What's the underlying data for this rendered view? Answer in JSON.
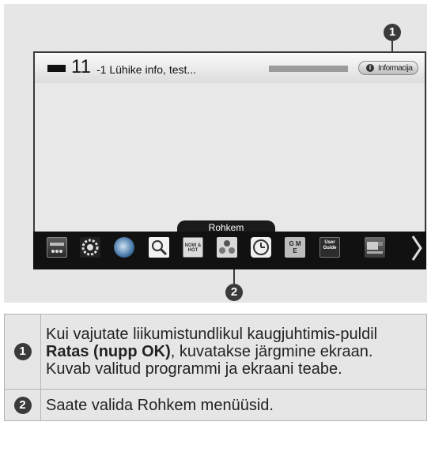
{
  "screen": {
    "channel_number": "11",
    "channel_title": "-1 Lühike info, test...",
    "info_button_label": "Informacija",
    "menu_tab_label": "Rohkem",
    "menu_icons": [
      {
        "name": "source-icon"
      },
      {
        "name": "settings-icon"
      },
      {
        "name": "globe-icon"
      },
      {
        "name": "search-icon"
      },
      {
        "name": "now-hot-icon",
        "text": "NOW & HOT"
      },
      {
        "name": "smart-share-icon"
      },
      {
        "name": "clock-icon"
      },
      {
        "name": "game-icon",
        "text": "G M E"
      },
      {
        "name": "user-guide-icon",
        "text": "User Guide"
      },
      {
        "name": "tv-guide-icon"
      }
    ]
  },
  "markers": [
    "1",
    "2"
  ],
  "legend": [
    {
      "marker": "1",
      "line1_before": "Kui vajutate liikumistundlikul kaugjuhtimis-puldil ",
      "line1_bold": "Ratas (nupp OK)",
      "line1_after": ", kuvatakse järgmine ekraan.",
      "line2": "Kuvab valitud programmi ja ekraani teabe."
    },
    {
      "marker": "2",
      "text": "Saate valida Rohkem menüüsid."
    }
  ]
}
